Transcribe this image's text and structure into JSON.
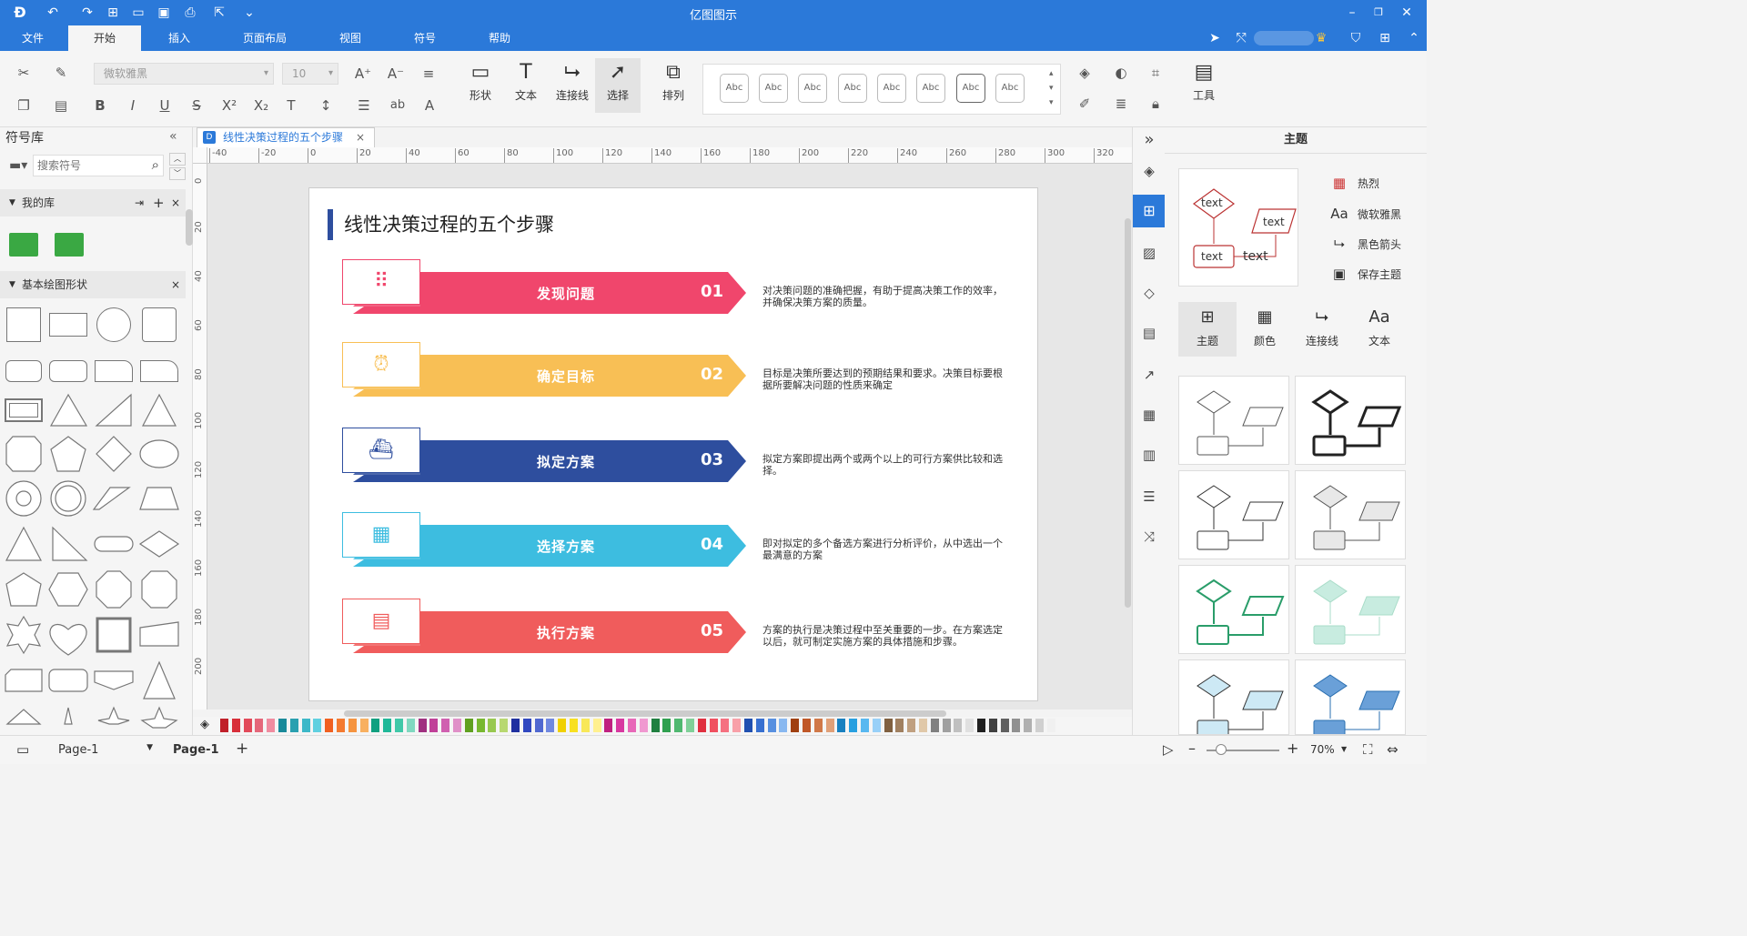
{
  "app": {
    "title": "亿图图示"
  },
  "menu": {
    "items": [
      "文件",
      "开始",
      "插入",
      "页面布局",
      "视图",
      "符号",
      "帮助"
    ],
    "active": "开始"
  },
  "ribbon": {
    "font_family": "微软雅黑",
    "font_size": "10",
    "buttons": {
      "shape": "形状",
      "text": "文本",
      "connector": "连接线",
      "select": "选择",
      "arrange": "排列",
      "tools": "工具"
    },
    "styles": [
      "Abc",
      "Abc",
      "Abc",
      "Abc",
      "Abc",
      "Abc",
      "Abc",
      "Abc"
    ]
  },
  "library": {
    "title": "符号库",
    "search_placeholder": "搜索符号",
    "my_library": "我的库",
    "basic_shapes": "基本绘图形状",
    "accent": "#3aa843"
  },
  "document": {
    "tab_title": "线性决策过程的五个步骤",
    "ruler_h": [
      "-40",
      "-20",
      "0",
      "20",
      "40",
      "60",
      "80",
      "100",
      "120",
      "140",
      "160",
      "180",
      "200",
      "220",
      "240",
      "260",
      "280",
      "300",
      "320"
    ],
    "ruler_v": [
      "0",
      "20",
      "40",
      "60",
      "80",
      "100",
      "120",
      "140",
      "160",
      "180",
      "200"
    ],
    "heading": "线性决策过程的五个步骤",
    "steps": [
      {
        "label": "发现问题",
        "number": "01",
        "icon": "grid-icon",
        "color": "#f0466c",
        "description": "对决策问题的准确把握，有助于提高决策工作的效率，并确保决策方案的质量。"
      },
      {
        "label": "确定目标",
        "number": "02",
        "icon": "alarm-clock-icon",
        "color": "#f8bf55",
        "description": "目标是决策所要达到的预期结果和要求。决策目标要根据所要解决问题的性质来确定"
      },
      {
        "label": "拟定方案",
        "number": "03",
        "icon": "ship-icon",
        "color": "#2e4e9e",
        "description": "拟定方案即提出两个或两个以上的可行方案供比较和选择。"
      },
      {
        "label": "选择方案",
        "number": "04",
        "icon": "calendar-icon",
        "color": "#3dbde0",
        "description": "即对拟定的多个备选方案进行分析评价，从中选出一个最满意的方案"
      },
      {
        "label": "执行方案",
        "number": "05",
        "icon": "clipboard-icon",
        "color": "#f05c5c",
        "description": "方案的执行是决策过程中至关重要的一步。在方案选定以后，就可制定实施方案的具体措施和步骤。"
      }
    ]
  },
  "theme_panel": {
    "title": "主题",
    "preview_texts": [
      "text",
      "text",
      "text",
      "text"
    ],
    "options": [
      {
        "icon": "palette-grid-icon",
        "label": "热烈"
      },
      {
        "icon": "font-icon",
        "label": "微软雅黑"
      },
      {
        "icon": "connector-arrow-icon",
        "label": "黑色箭头"
      },
      {
        "icon": "save-icon",
        "label": "保存主题"
      }
    ],
    "tabs": [
      {
        "icon": "theme-icon",
        "label": "主题",
        "glyph": "⊞"
      },
      {
        "icon": "color-icon",
        "label": "颜色",
        "glyph": "▦"
      },
      {
        "icon": "connector-icon",
        "label": "连接线",
        "glyph": "⮡"
      },
      {
        "icon": "text-icon",
        "label": "文本",
        "glyph": "Aa"
      }
    ]
  },
  "status": {
    "page_selector": "Page-1",
    "active_page": "Page-1",
    "zoom": "70%"
  }
}
